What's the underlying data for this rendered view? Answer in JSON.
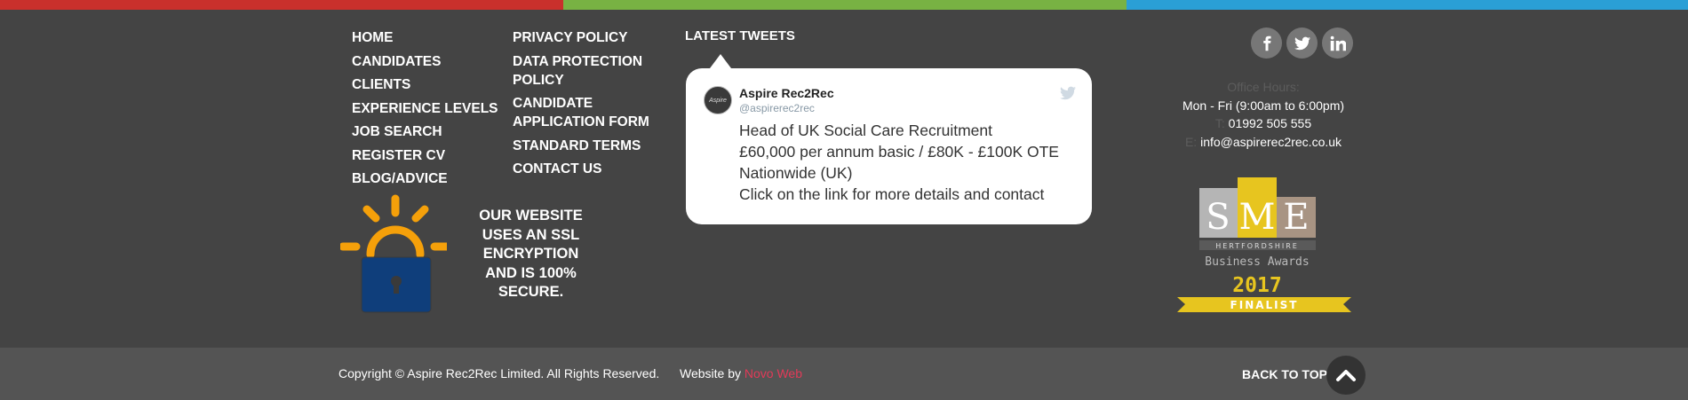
{
  "colors": {
    "red": "#c9302c",
    "green": "#78b243",
    "blue": "#2a9fd6",
    "background": "#444444",
    "footer": "#545454",
    "link_accent": "#e23a58",
    "lock_orange": "#f5a00a",
    "lock_blue": "#0f3e7b",
    "sme_yellow": "#e7c51f"
  },
  "nav_primary": [
    "HOME",
    "CANDIDATES",
    "CLIENTS",
    "EXPERIENCE LEVELS",
    "JOB SEARCH",
    "REGISTER CV",
    "BLOG/ADVICE"
  ],
  "nav_secondary": [
    "PRIVACY POLICY",
    "DATA PROTECTION POLICY",
    "CANDIDATE APPLICATION FORM",
    "STANDARD TERMS",
    "CONTACT US"
  ],
  "ssl": {
    "text": "OUR WEBSITE USES AN SSL ENCRYPTION AND IS 100% SECURE.",
    "icon": "padlock-icon"
  },
  "tweets": {
    "title": "LATEST TWEETS",
    "author_name": "Aspire Rec2Rec",
    "author_handle": "@aspirerec2rec",
    "avatar_text": "Aspire",
    "lines": [
      "Head of UK Social Care Recruitment",
      "£60,000 per annum basic / £80K - £100K OTE",
      "Nationwide (UK)",
      "Click on the link for more details and contact"
    ]
  },
  "social_icons": [
    "facebook-icon",
    "twitter-icon",
    "linkedin-icon"
  ],
  "contact": {
    "hours_label": "Office Hours:",
    "hours": "Mon - Fri (9:00am to 6:00pm)",
    "phone_prefix": "T:",
    "phone": "01992 505 555",
    "email_prefix": "E:",
    "email": "info@aspirerec2rec.co.uk"
  },
  "award": {
    "letters": [
      "S",
      "M",
      "E"
    ],
    "region": "HERTFORDSHIRE",
    "name": "Business Awards",
    "year": "2017",
    "status": "FINALIST"
  },
  "footer": {
    "copyright": "Copyright © Aspire Rec2Rec Limited. All Rights Reserved.",
    "website_by_label": "Website by",
    "website_by_link": "Novo Web",
    "back_to_top": "BACK TO TOP"
  }
}
